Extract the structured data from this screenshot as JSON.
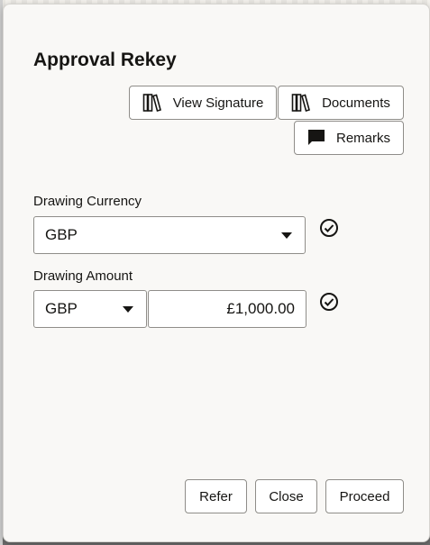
{
  "dialog": {
    "title": "Approval Rekey",
    "toolbar": {
      "view_signature_label": "View Signature",
      "documents_label": "Documents",
      "remarks_label": "Remarks"
    },
    "drawing_currency": {
      "label": "Drawing Currency",
      "value": "GBP"
    },
    "drawing_amount": {
      "label": "Drawing Amount",
      "currency": "GBP",
      "amount": "£1,000.00"
    },
    "footer": {
      "refer_label": "Refer",
      "close_label": "Close",
      "proceed_label": "Proceed"
    }
  }
}
